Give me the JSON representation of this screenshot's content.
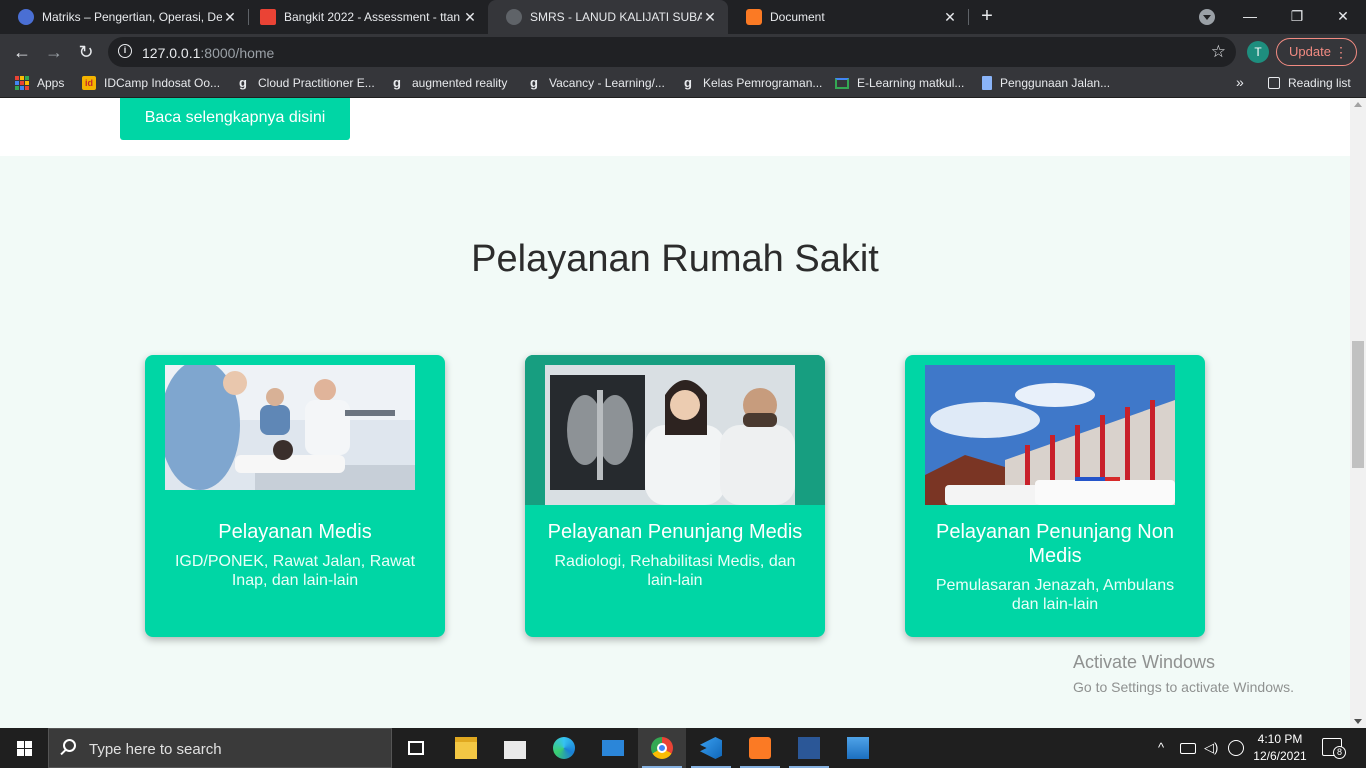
{
  "browser": {
    "tabs": [
      {
        "title": "Matriks – Pengertian, Operasi, De",
        "close": "✕",
        "active": false,
        "favicon_color": "#4a6fd4"
      },
      {
        "title": "Bangkit 2022 - Assessment - ttan",
        "close": "✕",
        "active": false,
        "favicon_color": "#ea4335"
      },
      {
        "title": "SMRS - LANUD KALIJATI SUBANG",
        "close": "✕",
        "active": true,
        "favicon_color": "#5f6368"
      },
      {
        "title": "Document",
        "close": "✕",
        "active": false,
        "favicon_color": "#fb7a24"
      }
    ],
    "new_tab": "+",
    "window_controls": {
      "minimize": "—",
      "maximize": "❐",
      "close": "✕"
    },
    "nav": {
      "back": "←",
      "forward": "→",
      "reload": "↻"
    },
    "address": {
      "host": "127.0.0.1",
      "path": ":8000/home",
      "info_icon": "i",
      "star": "☆"
    },
    "profile_initial": "T",
    "update_label": "Update",
    "menu_dots": "⋮",
    "bookmarks": [
      {
        "label": "Apps",
        "icon": "apps-grid-icon"
      },
      {
        "label": "IDCamp Indosat Oo...",
        "icon": "idcamp-icon"
      },
      {
        "label": "Cloud Practitioner E...",
        "icon": "dicoding-icon"
      },
      {
        "label": "augmented reality",
        "icon": "dicoding-icon"
      },
      {
        "label": "Vacancy - Learning/...",
        "icon": "dicoding-icon"
      },
      {
        "label": "Kelas Pemrograman...",
        "icon": "dicoding-icon"
      },
      {
        "label": "E-Learning matkul...",
        "icon": "elearning-icon"
      },
      {
        "label": "Penggunaan Jalan...",
        "icon": "document-icon"
      }
    ],
    "bookmarks_overflow": "»",
    "reading_list": "Reading list"
  },
  "page": {
    "read_more_button": "Baca selengkapnya disini",
    "section_title": "Pelayanan Rumah Sakit",
    "cards": [
      {
        "title": "Pelayanan Medis",
        "description": "IGD/PONEK, Rawat Jalan, Rawat Inap, dan lain-lain"
      },
      {
        "title": "Pelayanan Penunjang Medis",
        "description": "Radiologi, Rehabilitasi Medis, dan lain-lain"
      },
      {
        "title": "Pelayanan Penunjang Non Medis",
        "description": "Pemulasaran Jenazah, Ambulans dan lain-lain"
      }
    ],
    "watermark": {
      "line1": "Activate Windows",
      "line2": "Go to Settings to activate Windows."
    }
  },
  "taskbar": {
    "search_placeholder": "Type here to search",
    "time": "4:10 PM",
    "date": "12/6/2021",
    "notification_count": "8",
    "colors": {
      "accent": "#00d6a5",
      "taskbar": "#1f1f1f"
    }
  }
}
